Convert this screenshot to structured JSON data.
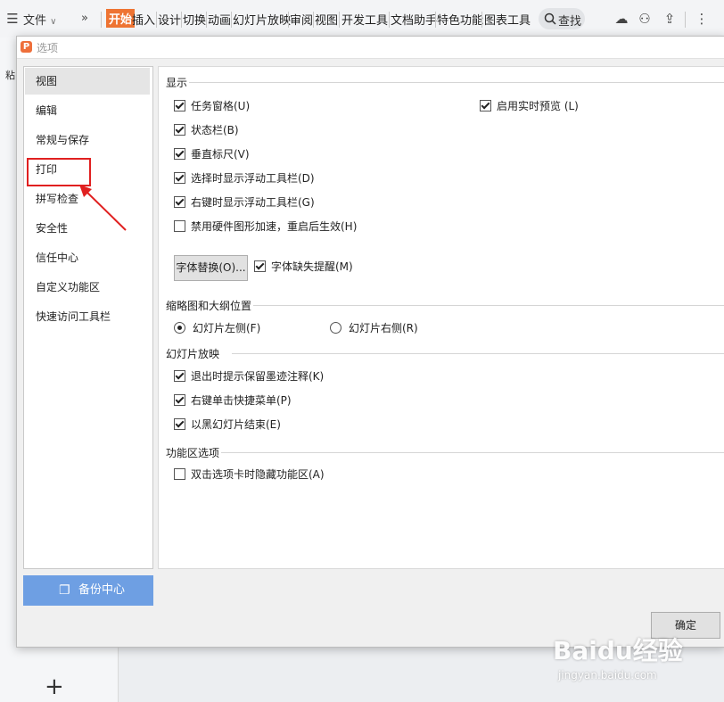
{
  "ribbon": {
    "file_menu": "文件",
    "tabs": [
      "开始",
      "插入",
      "设计",
      "切换",
      "动画",
      "幻灯片放映",
      "审阅",
      "视图",
      "开发工具",
      "文档助手",
      "特色功能",
      "图表工具"
    ],
    "active_tab": "开始",
    "search_label": "查找",
    "accent_color": "#ee7433"
  },
  "background": {
    "paste_label": "粘"
  },
  "dialog": {
    "title": "选项",
    "nav_items": [
      "视图",
      "编辑",
      "常规与保存",
      "打印",
      "拼写检查",
      "安全性",
      "信任中心",
      "自定义功能区",
      "快速访问工具栏"
    ],
    "selected_nav": "视图",
    "highlighted_nav": "打印",
    "backup_label": "备份中心",
    "ok_label": "确定",
    "display": {
      "heading": "显示",
      "options": [
        {
          "label": "任务窗格(U)",
          "checked": true
        },
        {
          "label": "状态栏(B)",
          "checked": true
        },
        {
          "label": "垂直标尺(V)",
          "checked": true
        },
        {
          "label": "选择时显示浮动工具栏(D)",
          "checked": true
        },
        {
          "label": "右键时显示浮动工具栏(G)",
          "checked": true
        },
        {
          "label": "禁用硬件图形加速，重启后生效(H)",
          "checked": false
        }
      ],
      "live_preview": {
        "label": "启用实时预览  (L)",
        "checked": true
      },
      "font_replace_button": "字体替换(O)...",
      "font_missing_alert": {
        "label": "字体缺失提醒(M)",
        "checked": true
      }
    },
    "thumbnail": {
      "heading": "缩略图和大纲位置",
      "left": {
        "label": "幻灯片左侧(F)",
        "checked": true
      },
      "right": {
        "label": "幻灯片右侧(R)",
        "checked": false
      }
    },
    "slideshow": {
      "heading": "幻灯片放映",
      "options": [
        {
          "label": "退出时提示保留墨迹注释(K)",
          "checked": true
        },
        {
          "label": "右键单击快捷菜单(P)",
          "checked": true
        },
        {
          "label": "以黑幻灯片结束(E)",
          "checked": true
        }
      ]
    },
    "ribbon_options": {
      "heading": "功能区选项",
      "options": [
        {
          "label": "双击选项卡时隐藏功能区(A)",
          "checked": false
        }
      ]
    }
  },
  "watermark": {
    "brand": "Baidu经验",
    "url": "jingyan.baidu.com"
  }
}
